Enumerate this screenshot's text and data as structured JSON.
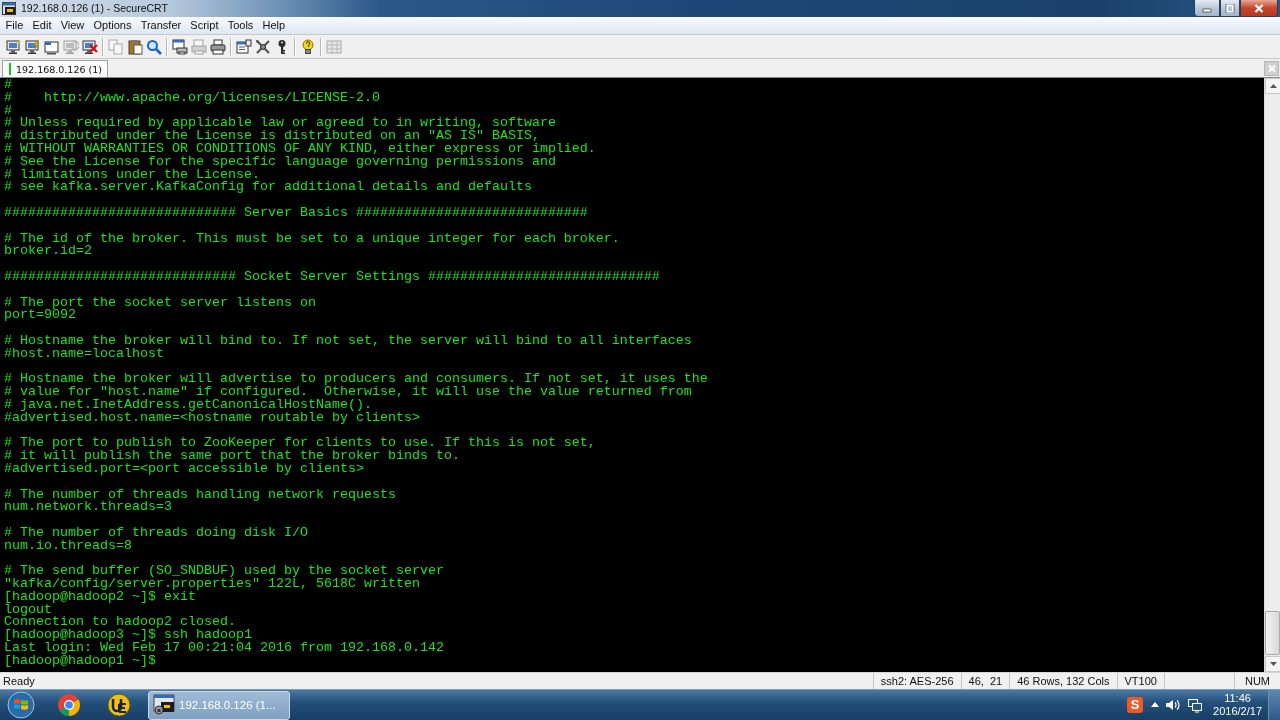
{
  "window": {
    "title": "192.168.0.126 (1) - SecureCRT"
  },
  "menu": [
    "File",
    "Edit",
    "View",
    "Options",
    "Transfer",
    "Script",
    "Tools",
    "Help"
  ],
  "toolbar": {
    "groups": [
      [
        {
          "kind": "monitor",
          "disabled": false
        },
        {
          "kind": "monitor_bolt",
          "disabled": false
        },
        {
          "kind": "window_tab",
          "disabled": false
        },
        {
          "kind": "monitor_arrow",
          "disabled": true
        },
        {
          "kind": "monitor_x",
          "disabled": false
        }
      ],
      [
        {
          "kind": "copy",
          "disabled": true
        },
        {
          "kind": "clipboard",
          "disabled": false
        },
        {
          "kind": "magnifier",
          "disabled": false
        }
      ],
      [
        {
          "kind": "window_printer",
          "disabled": false
        },
        {
          "kind": "printer_page",
          "disabled": true
        },
        {
          "kind": "printer",
          "disabled": false
        }
      ],
      [
        {
          "kind": "window_list",
          "disabled": false
        },
        {
          "kind": "crossed_tools",
          "disabled": false
        },
        {
          "kind": "key",
          "disabled": false
        }
      ],
      [
        {
          "kind": "lightbulb",
          "disabled": false
        }
      ],
      [
        {
          "kind": "grid_window",
          "disabled": true
        }
      ]
    ]
  },
  "tabs": [
    {
      "label": "192.168.0.126 (1)",
      "selected": true,
      "connected": true
    }
  ],
  "terminal": {
    "blocks": [
      [
        "#",
        "#    http://www.apache.org/licenses/LICENSE-2.0",
        "#",
        "# Unless required by applicable law or agreed to in writing, software",
        "# distributed under the License is distributed on an \"AS IS\" BASIS,",
        "# WITHOUT WARRANTIES OR CONDITIONS OF ANY KIND, either express or implied.",
        "# See the License for the specific language governing permissions and",
        "# limitations under the License.",
        "# see kafka.server.KafkaConfig for additional details and defaults"
      ],
      [
        "############################# Server Basics #############################"
      ],
      [
        "# The id of the broker. This must be set to a unique integer for each broker.",
        "broker.id=2"
      ],
      [
        "############################# Socket Server Settings #############################"
      ],
      [
        "# The port the socket server listens on",
        "port=9092"
      ],
      [
        "# Hostname the broker will bind to. If not set, the server will bind to all interfaces",
        "#host.name=localhost"
      ],
      [
        "# Hostname the broker will advertise to producers and consumers. If not set, it uses the",
        "# value for \"host.name\" if configured.  Otherwise, it will use the value returned from",
        "# java.net.InetAddress.getCanonicalHostName().",
        "#advertised.host.name=<hostname routable by clients>"
      ],
      [
        "# The port to publish to ZooKeeper for clients to use. If this is not set,",
        "# it will publish the same port that the broker binds to.",
        "#advertised.port=<port accessible by clients>"
      ],
      [
        "# The number of threads handling network requests",
        "num.network.threads=3"
      ],
      [
        "# The number of threads doing disk I/O",
        "num.io.threads=8"
      ],
      [
        "# The send buffer (SO_SNDBUF) used by the socket server",
        "\"kafka/config/server.properties\" 122L, 5618C written",
        "[hadoop@hadoop2 ~]$ exit",
        "logout",
        "Connection to hadoop2 closed.",
        "[hadoop@hadoop3 ~]$ ssh hadoop1",
        "Last login: Wed Feb 17 00:21:04 2016 from 192.168.0.142",
        "[hadoop@hadoop1 ~]$"
      ]
    ]
  },
  "status_bar": {
    "message": "Ready",
    "panes": [
      "ssh2: AES-256",
      "46,  21",
      "46 Rows, 132 Cols",
      "VT100"
    ],
    "num": "NUM"
  },
  "taskbar": {
    "tasks": [
      {
        "label": "192.168.0.126 (1...",
        "selected": true
      }
    ],
    "tray": {
      "ime": "S",
      "time": "11:46",
      "date": "2016/2/17"
    }
  }
}
